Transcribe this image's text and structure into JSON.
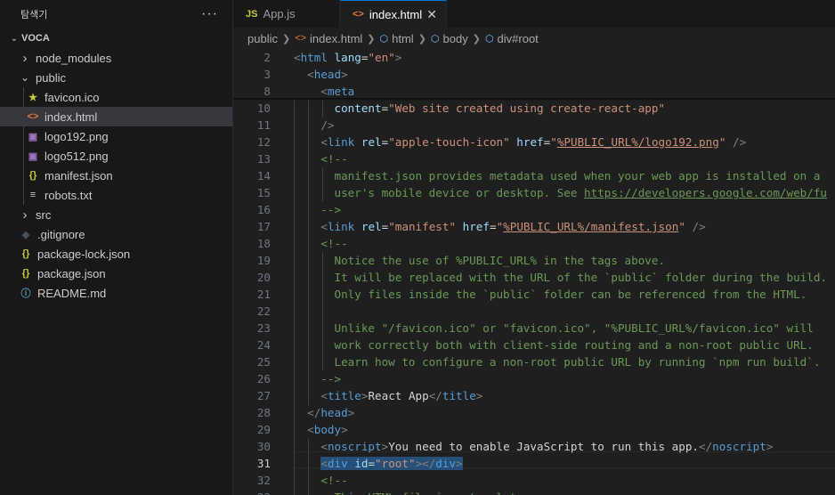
{
  "explorer": {
    "title": "탐색기",
    "more": "···",
    "root": "VOCA",
    "items": [
      {
        "label": "node_modules",
        "type": "folder",
        "expanded": false
      },
      {
        "label": "public",
        "type": "folder",
        "expanded": true
      },
      {
        "label": "favicon.ico",
        "type": "file",
        "icon": "star-icon"
      },
      {
        "label": "index.html",
        "type": "file",
        "icon": "html-icon",
        "selected": true
      },
      {
        "label": "logo192.png",
        "type": "file",
        "icon": "image-icon"
      },
      {
        "label": "logo512.png",
        "type": "file",
        "icon": "image-icon"
      },
      {
        "label": "manifest.json",
        "type": "file",
        "icon": "json-icon"
      },
      {
        "label": "robots.txt",
        "type": "file",
        "icon": "lines-icon"
      },
      {
        "label": "src",
        "type": "folder",
        "expanded": false
      },
      {
        "label": ".gitignore",
        "type": "file",
        "icon": "git-icon"
      },
      {
        "label": "package-lock.json",
        "type": "file",
        "icon": "json-icon"
      },
      {
        "label": "package.json",
        "type": "file",
        "icon": "json-icon"
      },
      {
        "label": "README.md",
        "type": "file",
        "icon": "info-icon"
      }
    ]
  },
  "tabs": [
    {
      "label": "App.js",
      "icon_text": "JS",
      "active": false
    },
    {
      "label": "index.html",
      "icon_text": "<>",
      "active": true,
      "close": "✕"
    }
  ],
  "breadcrumb": [
    "public",
    "index.html",
    "html",
    "body",
    "div#root"
  ],
  "editor": {
    "current_line": 31,
    "lines": [
      {
        "n": 2,
        "tokens": [
          [
            "b",
            "<"
          ],
          [
            "t",
            "html"
          ],
          [
            "p",
            " "
          ],
          [
            "a",
            "lang"
          ],
          [
            "p",
            "="
          ],
          [
            "s",
            "\"en\""
          ],
          [
            "b",
            ">"
          ]
        ]
      },
      {
        "n": 3,
        "tokens": [
          [
            "p",
            "  "
          ],
          [
            "b",
            "<"
          ],
          [
            "t",
            "head"
          ],
          [
            "b",
            ">"
          ]
        ]
      },
      {
        "n": 8,
        "tokens": [
          [
            "p",
            "    "
          ],
          [
            "b",
            "<"
          ],
          [
            "t",
            "meta"
          ]
        ]
      },
      {
        "n": 10,
        "tokens": [
          [
            "p",
            "      "
          ],
          [
            "a",
            "content"
          ],
          [
            "p",
            "="
          ],
          [
            "s",
            "\"Web site created using create-react-app\""
          ]
        ]
      },
      {
        "n": 11,
        "tokens": [
          [
            "p",
            "    "
          ],
          [
            "b",
            "/>"
          ]
        ]
      },
      {
        "n": 12,
        "tokens": [
          [
            "p",
            "    "
          ],
          [
            "b",
            "<"
          ],
          [
            "t",
            "link"
          ],
          [
            "p",
            " "
          ],
          [
            "a",
            "rel"
          ],
          [
            "p",
            "="
          ],
          [
            "s",
            "\"apple-touch-icon\""
          ],
          [
            "p",
            " "
          ],
          [
            "a",
            "href"
          ],
          [
            "p",
            "="
          ],
          [
            "s",
            "\""
          ],
          [
            "su",
            "%PUBLIC_URL%/logo192.png"
          ],
          [
            "s",
            "\""
          ],
          [
            "p",
            " "
          ],
          [
            "b",
            "/>"
          ]
        ]
      },
      {
        "n": 13,
        "tokens": [
          [
            "p",
            "    "
          ],
          [
            "c",
            "<!--"
          ]
        ]
      },
      {
        "n": 14,
        "tokens": [
          [
            "p",
            "      "
          ],
          [
            "c",
            "manifest.json provides metadata used when your web app is installed on a"
          ]
        ]
      },
      {
        "n": 15,
        "tokens": [
          [
            "p",
            "      "
          ],
          [
            "c",
            "user's mobile device or desktop. See "
          ],
          [
            "cu",
            "https://developers.google.com/web/fu"
          ]
        ]
      },
      {
        "n": 16,
        "tokens": [
          [
            "p",
            "    "
          ],
          [
            "c",
            "-->"
          ]
        ]
      },
      {
        "n": 17,
        "tokens": [
          [
            "p",
            "    "
          ],
          [
            "b",
            "<"
          ],
          [
            "t",
            "link"
          ],
          [
            "p",
            " "
          ],
          [
            "a",
            "rel"
          ],
          [
            "p",
            "="
          ],
          [
            "s",
            "\"manifest\""
          ],
          [
            "p",
            " "
          ],
          [
            "a",
            "href"
          ],
          [
            "p",
            "="
          ],
          [
            "s",
            "\""
          ],
          [
            "su",
            "%PUBLIC_URL%/manifest.json"
          ],
          [
            "s",
            "\""
          ],
          [
            "p",
            " "
          ],
          [
            "b",
            "/>"
          ]
        ]
      },
      {
        "n": 18,
        "tokens": [
          [
            "p",
            "    "
          ],
          [
            "c",
            "<!--"
          ]
        ]
      },
      {
        "n": 19,
        "tokens": [
          [
            "p",
            "      "
          ],
          [
            "c",
            "Notice the use of %PUBLIC_URL% in the tags above."
          ]
        ]
      },
      {
        "n": 20,
        "tokens": [
          [
            "p",
            "      "
          ],
          [
            "c",
            "It will be replaced with the URL of the `public` folder during the build."
          ]
        ]
      },
      {
        "n": 21,
        "tokens": [
          [
            "p",
            "      "
          ],
          [
            "c",
            "Only files inside the `public` folder can be referenced from the HTML."
          ]
        ]
      },
      {
        "n": 22,
        "tokens": []
      },
      {
        "n": 23,
        "tokens": [
          [
            "p",
            "      "
          ],
          [
            "c",
            "Unlike \"/favicon.ico\" or \"favicon.ico\", \"%PUBLIC_URL%/favicon.ico\" will"
          ]
        ]
      },
      {
        "n": 24,
        "tokens": [
          [
            "p",
            "      "
          ],
          [
            "c",
            "work correctly both with client-side routing and a non-root public URL."
          ]
        ]
      },
      {
        "n": 25,
        "tokens": [
          [
            "p",
            "      "
          ],
          [
            "c",
            "Learn how to configure a non-root public URL by running `npm run build`."
          ]
        ]
      },
      {
        "n": 26,
        "tokens": [
          [
            "p",
            "    "
          ],
          [
            "c",
            "-->"
          ]
        ]
      },
      {
        "n": 27,
        "tokens": [
          [
            "p",
            "    "
          ],
          [
            "b",
            "<"
          ],
          [
            "t",
            "title"
          ],
          [
            "b",
            ">"
          ],
          [
            "p",
            "React App"
          ],
          [
            "b",
            "</"
          ],
          [
            "t",
            "title"
          ],
          [
            "b",
            ">"
          ]
        ]
      },
      {
        "n": 28,
        "tokens": [
          [
            "p",
            "  "
          ],
          [
            "b",
            "</"
          ],
          [
            "t",
            "head"
          ],
          [
            "b",
            ">"
          ]
        ]
      },
      {
        "n": 29,
        "tokens": [
          [
            "p",
            "  "
          ],
          [
            "b",
            "<"
          ],
          [
            "t",
            "body"
          ],
          [
            "b",
            ">"
          ]
        ]
      },
      {
        "n": 30,
        "tokens": [
          [
            "p",
            "    "
          ],
          [
            "b",
            "<"
          ],
          [
            "t",
            "noscript"
          ],
          [
            "b",
            ">"
          ],
          [
            "p",
            "You need to enable JavaScript to run this app."
          ],
          [
            "b",
            "</"
          ],
          [
            "t",
            "noscript"
          ],
          [
            "b",
            ">"
          ]
        ]
      },
      {
        "n": 31,
        "tokens": [
          [
            "p",
            "    "
          ],
          [
            "Sb",
            "<"
          ],
          [
            "St",
            "div"
          ],
          [
            "Sp",
            " "
          ],
          [
            "Sa",
            "id"
          ],
          [
            "Sp",
            "="
          ],
          [
            "Ss",
            "\"root\""
          ],
          [
            "Sb",
            "></"
          ],
          [
            "St",
            "div"
          ],
          [
            "Sb",
            ">"
          ]
        ]
      },
      {
        "n": 32,
        "tokens": [
          [
            "p",
            "    "
          ],
          [
            "c",
            "<!--"
          ]
        ]
      },
      {
        "n": 33,
        "tokens": [
          [
            "p",
            "      "
          ],
          [
            "c",
            "This HTML file is a template."
          ]
        ]
      }
    ]
  }
}
